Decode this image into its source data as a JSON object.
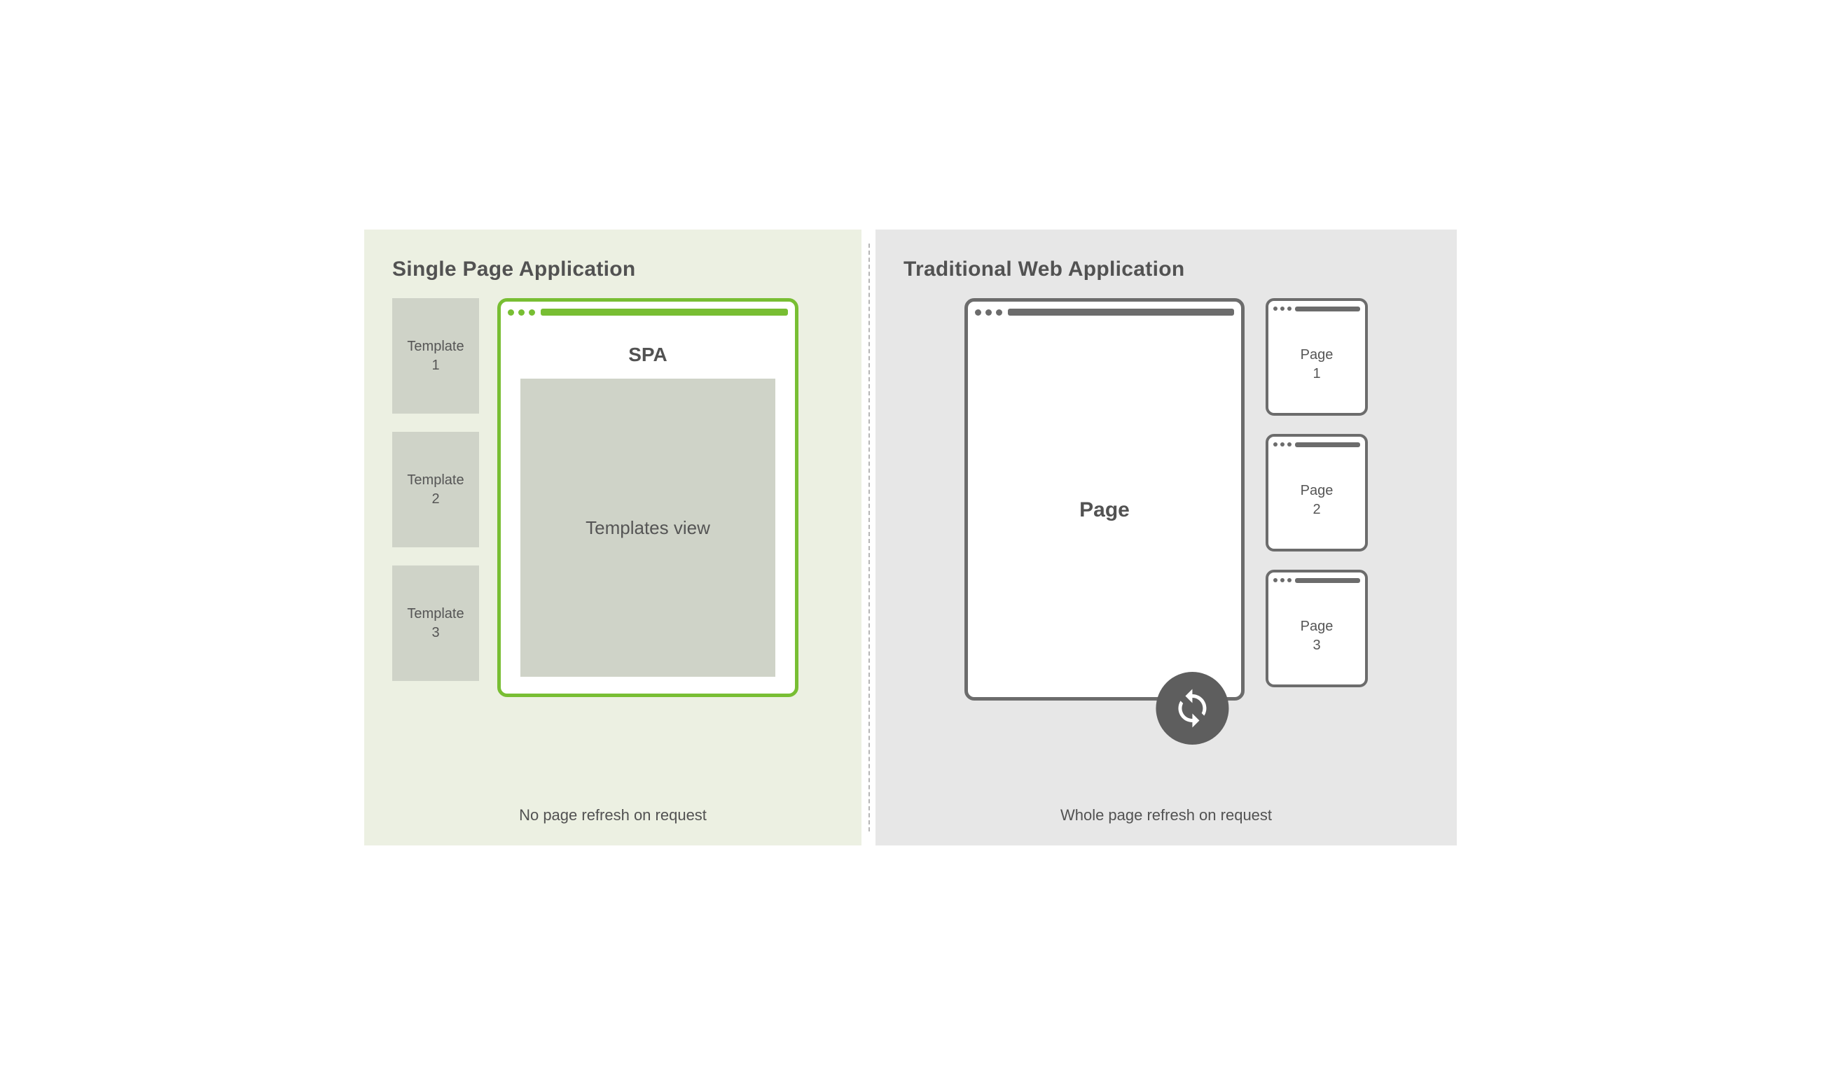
{
  "left": {
    "title": "Single Page Application",
    "templates": [
      "Template\n1",
      "Template\n2",
      "Template\n3"
    ],
    "window": {
      "label": "SPA",
      "view_label": "Templates view"
    },
    "caption": "No page refresh on request"
  },
  "right": {
    "title": "Traditional Web Application",
    "main_label": "Page",
    "pages": [
      "Page\n1",
      "Page\n2",
      "Page\n3"
    ],
    "caption": "Whole page refresh on request",
    "refresh_icon": "refresh-icon"
  },
  "colors": {
    "spa_accent": "#78be33",
    "trad_accent": "#6c6c6c"
  }
}
